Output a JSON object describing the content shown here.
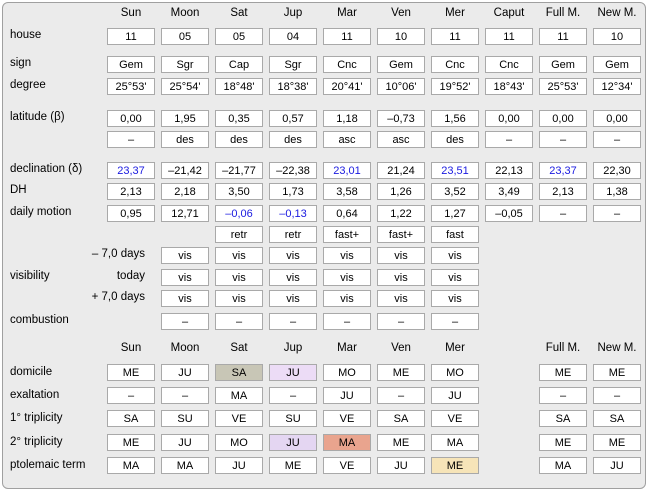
{
  "columns": [
    "Sun",
    "Moon",
    "Sat",
    "Jup",
    "Mar",
    "Ven",
    "Mer",
    "Caput",
    "Full M.",
    "New M."
  ],
  "row_labels": {
    "house": "house",
    "sign": "sign",
    "degree": "degree",
    "latitude": "latitude (β)",
    "declination": "declination (δ)",
    "dh": "DH",
    "daily_motion": "daily motion",
    "visibility": "visibility",
    "combustion": "combustion"
  },
  "visibility_sublabels": [
    "– 7,0 days",
    "today",
    "+ 7,0 days"
  ],
  "rows": {
    "house": [
      "11",
      "05",
      "05",
      "04",
      "11",
      "10",
      "11",
      "11",
      "11",
      "10"
    ],
    "sign": [
      "Gem",
      "Sgr",
      "Cap",
      "Sgr",
      "Cnc",
      "Gem",
      "Cnc",
      "Cnc",
      "Gem",
      "Gem"
    ],
    "degree": [
      "25°53'",
      "25°54'",
      "18°48'",
      "18°38'",
      "20°41'",
      "10°06'",
      "19°52'",
      "18°43'",
      "25°53'",
      "12°34'"
    ],
    "latitude": [
      "0,00",
      "1,95",
      "0,35",
      "0,57",
      "1,18",
      "–0,73",
      "1,56",
      "0,00",
      "0,00",
      "0,00"
    ],
    "lat_dir": [
      "–",
      "des",
      "des",
      "des",
      "asc",
      "asc",
      "des",
      "–",
      "–",
      "–"
    ],
    "declination": [
      "23,37",
      "–21,42",
      "–21,77",
      "–22,38",
      "23,01",
      "21,24",
      "23,51",
      "22,13",
      "23,37",
      "22,30"
    ],
    "dh": [
      "2,13",
      "2,18",
      "3,50",
      "1,73",
      "3,58",
      "1,26",
      "3,52",
      "3,49",
      "2,13",
      "1,38"
    ],
    "daily_motion": [
      "0,95",
      "12,71",
      "–0,06",
      "–0,13",
      "0,64",
      "1,22",
      "1,27",
      "–0,05",
      "–",
      "–"
    ],
    "motion_state": [
      "retr",
      "retr",
      "fast+",
      "fast+",
      "fast"
    ],
    "vis_minus": [
      "vis",
      "vis",
      "vis",
      "vis",
      "vis",
      "vis"
    ],
    "vis_today": [
      "vis",
      "vis",
      "vis",
      "vis",
      "vis",
      "vis"
    ],
    "vis_plus": [
      "vis",
      "vis",
      "vis",
      "vis",
      "vis",
      "vis"
    ],
    "combustion": [
      "–",
      "–",
      "–",
      "–",
      "–",
      "–"
    ]
  },
  "dignity_columns": [
    "Sun",
    "Moon",
    "Sat",
    "Jup",
    "Mar",
    "Ven",
    "Mer",
    "Full M.",
    "New M."
  ],
  "dignity_labels": {
    "domicile": "domicile",
    "exaltation": "exaltation",
    "triplicity1": "1° triplicity",
    "triplicity2": "2° triplicity",
    "term": "ptolemaic term"
  },
  "dignity": {
    "domicile": [
      "ME",
      "JU",
      "SA",
      "JU",
      "MO",
      "ME",
      "MO",
      "ME",
      "ME"
    ],
    "exaltation": [
      "–",
      "–",
      "MA",
      "–",
      "JU",
      "–",
      "JU",
      "–",
      "–"
    ],
    "triplicity1": [
      "SA",
      "SU",
      "VE",
      "SU",
      "VE",
      "SA",
      "VE",
      "SA",
      "SA"
    ],
    "triplicity2": [
      "ME",
      "JU",
      "MO",
      "JU",
      "MA",
      "ME",
      "MA",
      "ME",
      "ME"
    ],
    "term": [
      "MA",
      "MA",
      "JU",
      "ME",
      "VE",
      "JU",
      "ME",
      "MA",
      "JU"
    ]
  },
  "highlight_colors": {
    "domicile_sat": "#c8c6b6",
    "domicile_jup": "#ecdcf6",
    "triplicity2_jup": "#e4d6f2",
    "triplicity2_mar": "#e9a48e",
    "term_mer": "#f6e4b8",
    "negative_value": "#1a1ae0"
  }
}
